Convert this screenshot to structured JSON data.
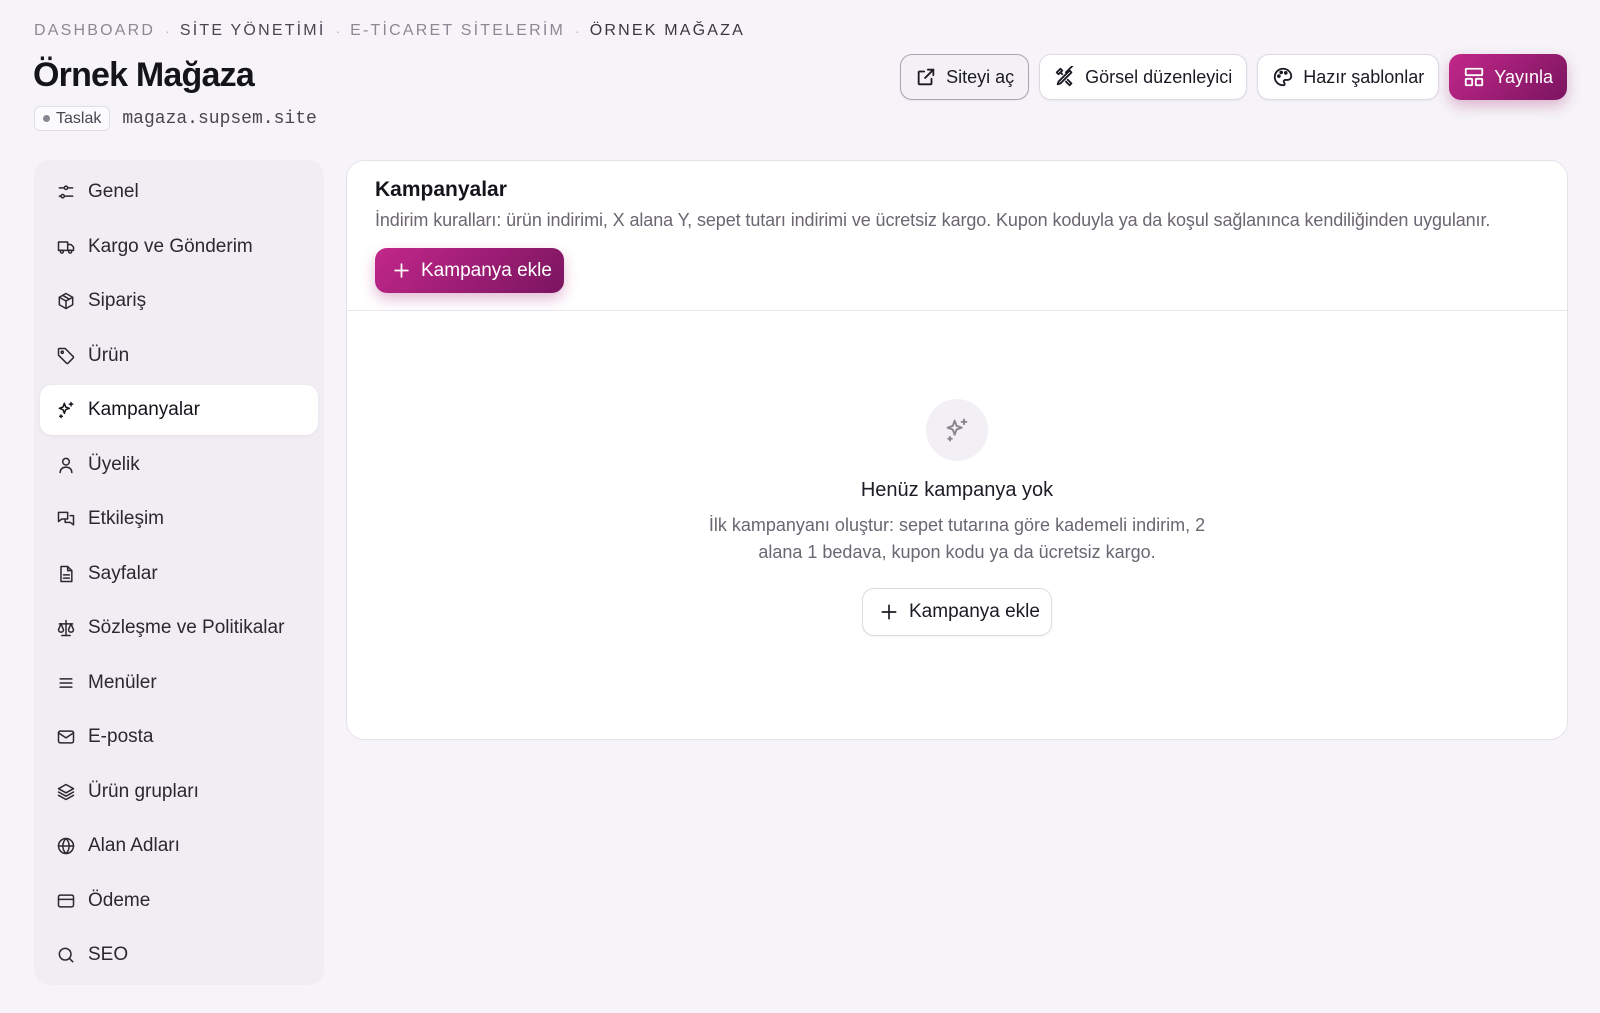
{
  "colors": {
    "accent": "#b0217d",
    "accent_dark": "#7a1560",
    "background": "#f6f4f8"
  },
  "breadcrumb": {
    "items": [
      "DASHBOARD",
      "SİTE YÖNETİMİ",
      "E-TİCARET SİTELERİM",
      "ÖRNEK MAĞAZA"
    ]
  },
  "page": {
    "title": "Örnek Mağaza",
    "status": "Taslak",
    "domain": "magaza.supsem.site"
  },
  "header_actions": {
    "open_site": "Siteyi aç",
    "visual_editor": "Görsel düzenleyici",
    "templates": "Hazır şablonlar",
    "publish": "Yayınla"
  },
  "sidebar": {
    "items": [
      {
        "label": "Genel",
        "icon": "sliders-icon"
      },
      {
        "label": "Kargo ve Gönderim",
        "icon": "truck-icon"
      },
      {
        "label": "Sipariş",
        "icon": "package-icon"
      },
      {
        "label": "Ürün",
        "icon": "tag-icon"
      },
      {
        "label": "Kampanyalar",
        "icon": "sparkles-icon",
        "active": true
      },
      {
        "label": "Üyelik",
        "icon": "user-icon"
      },
      {
        "label": "Etkileşim",
        "icon": "messages-icon"
      },
      {
        "label": "Sayfalar",
        "icon": "file-icon"
      },
      {
        "label": "Sözleşme ve Politikalar",
        "icon": "scale-icon"
      },
      {
        "label": "Menüler",
        "icon": "menu-icon"
      },
      {
        "label": "E-posta",
        "icon": "mail-icon"
      },
      {
        "label": "Ürün grupları",
        "icon": "layers-icon"
      },
      {
        "label": "Alan Adları",
        "icon": "globe-icon"
      },
      {
        "label": "Ödeme",
        "icon": "credit-card-icon"
      },
      {
        "label": "SEO",
        "icon": "search-icon"
      }
    ]
  },
  "main": {
    "title": "Kampanyalar",
    "description": "İndirim kuralları: ürün indirimi, X alana Y, sepet tutarı indirimi ve ücretsiz kargo. Kupon koduyla ya da koşul sağlanınca kendiliğinden uygulanır.",
    "add_button": "Kampanya ekle",
    "empty": {
      "icon": "sparkles-icon",
      "title": "Henüz kampanya yok",
      "description": "İlk kampanyanı oluştur: sepet tutarına göre kademeli indirim, 2 alana 1 bedava, kupon kodu ya da ücretsiz kargo.",
      "button": "Kampanya ekle"
    }
  }
}
